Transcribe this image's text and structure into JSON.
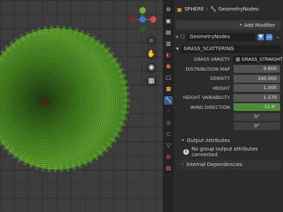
{
  "breadcrumb": {
    "object": "SPHERE",
    "modifier": "GeometryNodes"
  },
  "toolbar": {
    "add_modifier_label": "Add Modifier"
  },
  "modifier": {
    "name": "GeometryNodes",
    "node_group": "GRASS_SCATTERING"
  },
  "properties": [
    {
      "label": "GRASS VARIETY",
      "value": "GRASS_STRAIGHT",
      "kind": "text"
    },
    {
      "label": "DISTRIBUTION MAP",
      "value": "0.600",
      "kind": "num"
    },
    {
      "label": "DENSITY",
      "value": "100.000",
      "kind": "num"
    },
    {
      "label": "HEIGHT",
      "value": "1.000",
      "kind": "num"
    },
    {
      "label": "HEIGHT VARIABILITY",
      "value": "1.570",
      "kind": "num"
    },
    {
      "label": "WIND DIRECTION",
      "value": "12.6°",
      "kind": "wind"
    },
    {
      "label": "",
      "value": "0°",
      "kind": "sub"
    },
    {
      "label": "",
      "value": "0°",
      "kind": "sub"
    }
  ],
  "output_attributes": {
    "title": "Output Attributes",
    "message": "No group output attributes connected"
  },
  "internal_dependencies": {
    "title": "Internal Dependencies"
  },
  "colors": {
    "accent_blue": "#3b5c8c",
    "wind_green": "#4f8a3a",
    "axis_x": "#d94a4a",
    "axis_y": "#6bb33a",
    "axis_z": "#3b78d8"
  }
}
